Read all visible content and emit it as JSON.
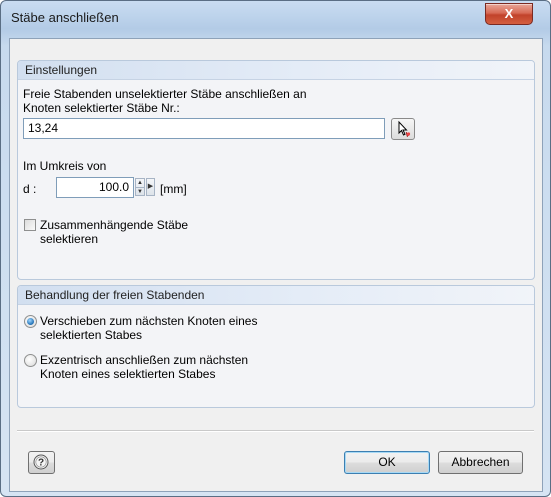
{
  "window": {
    "title": "Stäbe anschließen",
    "close_glyph": "X"
  },
  "settings": {
    "header": "Einstellungen",
    "instruction_line1": "Freie Stabenden unselektierter Stäbe anschließen an",
    "instruction_line2": "Knoten selektierter Stäbe Nr.:",
    "members_value": "13,24",
    "pick_icon": "pick-members-icon",
    "radius_label": "Im Umkreis von",
    "d_label": "d :",
    "d_value": "100.0",
    "d_unit": "[mm]",
    "connected_checkbox_line1": "Zusammenhängende Stäbe",
    "connected_checkbox_line2": "selektieren",
    "connected_checked": false
  },
  "treatment": {
    "header": "Behandlung der freien Stabenden",
    "options": [
      {
        "line1": "Verschieben zum nächsten Knoten eines",
        "line2": "selektierten Stabes",
        "selected": true
      },
      {
        "line1": "Exzentrisch anschließen zum nächsten",
        "line2": "Knoten eines selektierten Stabes",
        "selected": false
      }
    ]
  },
  "footer": {
    "help_icon": "help-icon",
    "ok_label": "OK",
    "cancel_label": "Abbrechen"
  },
  "colors": {
    "accent": "#3c7fb1",
    "close": "#c1422b",
    "group_header": "#d2dff0"
  }
}
